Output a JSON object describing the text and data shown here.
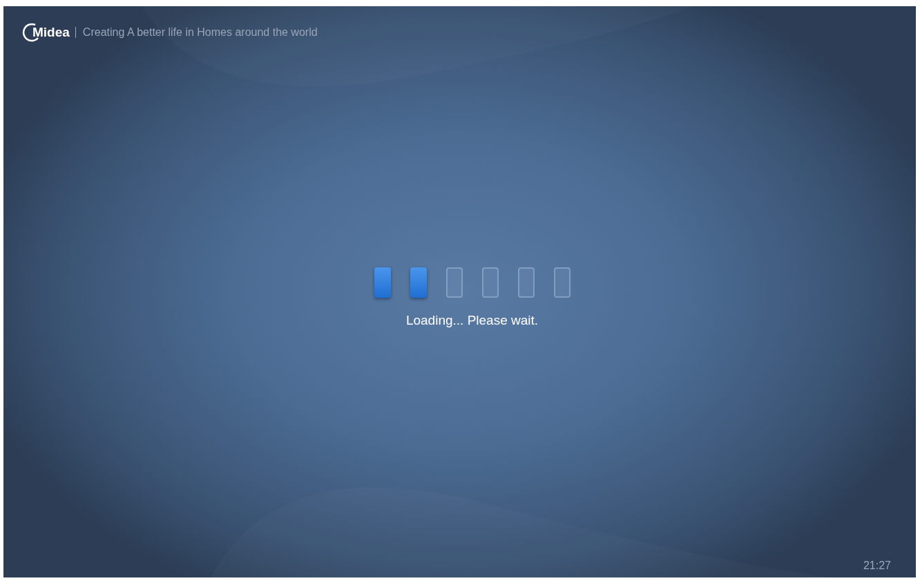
{
  "header": {
    "logo": "Midea",
    "tagline": "Creating A better life in Homes around the world"
  },
  "loader": {
    "blocks": [
      {
        "on": true
      },
      {
        "on": true
      },
      {
        "on": false
      },
      {
        "on": false
      },
      {
        "on": false
      },
      {
        "on": false
      }
    ],
    "message": "Loading... Please wait."
  },
  "clock": "21:27"
}
